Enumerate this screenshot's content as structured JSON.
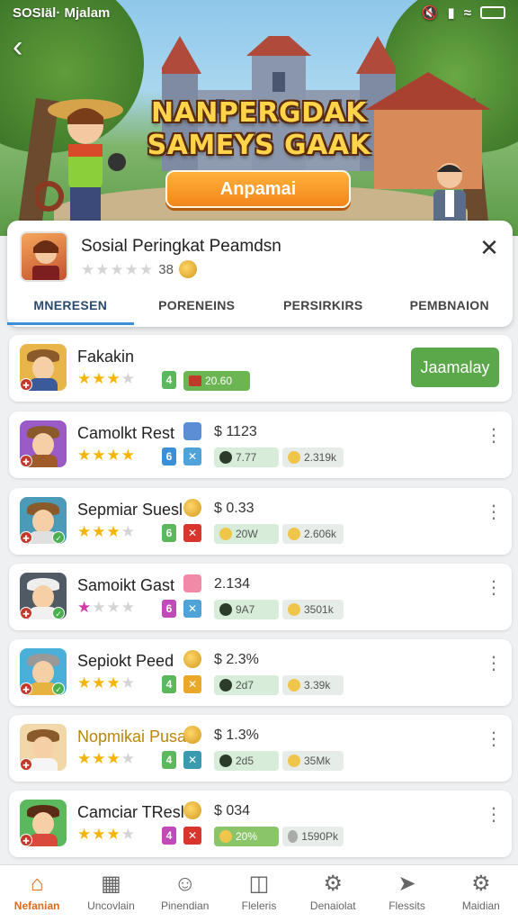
{
  "status": {
    "carrier": "SOSIäl· Mjalam"
  },
  "hero": {
    "title_line1": "NANPERGDAK",
    "title_line2": "SAMEYS GAAK",
    "cta_label": "Anpamai"
  },
  "app": {
    "title": "Sosial Peringkat Peamdsn",
    "rating_value": "38",
    "tabs": [
      "MNERESEN",
      "PORENEINS",
      "PERSIRKIRS",
      "PEMBNAION"
    ]
  },
  "rows": [
    {
      "name": "Fakakin",
      "stars": 3,
      "level": "4",
      "tag": "20.60",
      "action": "Jaamalay"
    },
    {
      "name": "Camolkt Rest",
      "stars": 4,
      "level": "6",
      "price": "$ 1123",
      "tag_a": "7.77",
      "tag_b": "2.319k"
    },
    {
      "name": "Sepmiar Suesl",
      "stars": 3,
      "level": "6",
      "price": "$ 0.33",
      "tag_a": "20W",
      "tag_b": "2.606k"
    },
    {
      "name": "Samoikt Gast",
      "stars": 1,
      "level": "6",
      "price": "2.134",
      "tag_a": "9A7",
      "tag_b": "3501k"
    },
    {
      "name": "Sepiokt Peed",
      "stars": 3,
      "level": "4",
      "price": "$ 2.3%",
      "tag_a": "2d7",
      "tag_b": "3.39k"
    },
    {
      "name": "Nopmikai Pusal",
      "stars": 3,
      "level": "4",
      "price": "$ 1.3%",
      "tag_a": "2d5",
      "tag_b": "35Mk"
    },
    {
      "name": "Camciar TResl",
      "stars": 3,
      "level": "4",
      "price": "$ 034",
      "tag_a": "20%",
      "tag_b": "1590Pk"
    }
  ],
  "nav": [
    {
      "label": "Nefanian",
      "icon": "home-icon"
    },
    {
      "label": "Uncovlain",
      "icon": "grid-icon"
    },
    {
      "label": "Pinendian",
      "icon": "person-icon"
    },
    {
      "label": "Fleleris",
      "icon": "trash-icon"
    },
    {
      "label": "Denaiolat",
      "icon": "gear-badge-icon"
    },
    {
      "label": "Flessits",
      "icon": "plane-icon"
    },
    {
      "label": "Maidian",
      "icon": "settings-icon"
    }
  ],
  "colors": {
    "accent_orange": "#f2861a",
    "accent_green": "#5ba84a",
    "tab_active": "#3c8fd6",
    "star": "#f5b400"
  }
}
